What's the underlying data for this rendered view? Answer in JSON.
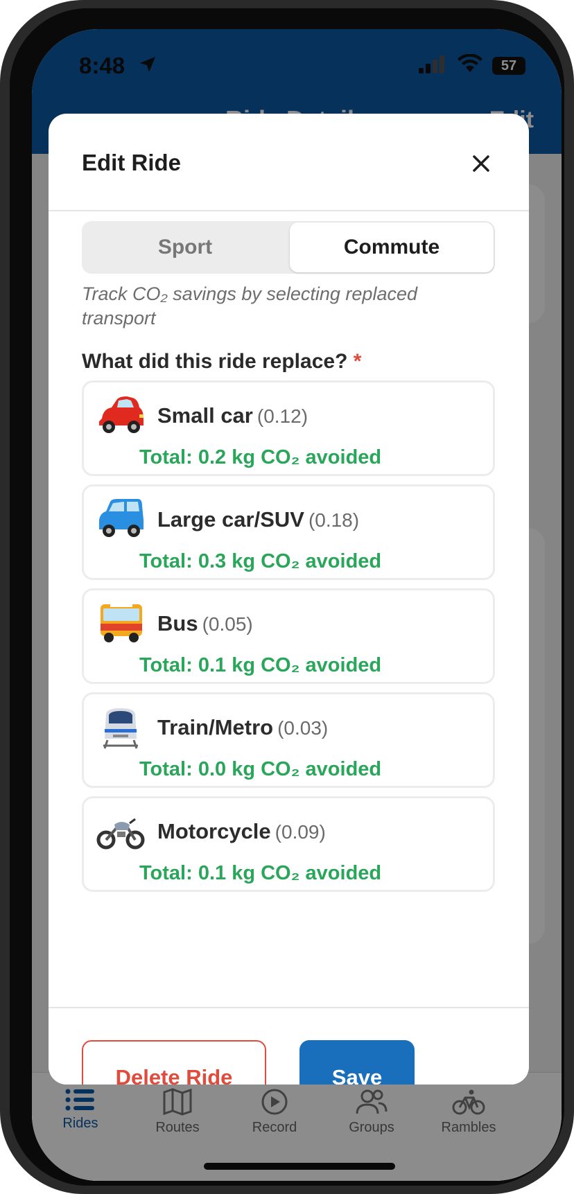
{
  "status_bar": {
    "time": "8:48",
    "battery": "57"
  },
  "app_header": {
    "title": "Ride Details",
    "edit_label": "Edit"
  },
  "tab_bar": {
    "items": [
      {
        "label": "Rides",
        "icon": "list-icon"
      },
      {
        "label": "Routes",
        "icon": "map-icon"
      },
      {
        "label": "Record",
        "icon": "play-icon"
      },
      {
        "label": "Groups",
        "icon": "group-icon"
      },
      {
        "label": "Rambles",
        "icon": "bike-icon"
      }
    ]
  },
  "modal": {
    "title": "Edit Ride",
    "segment": {
      "options": [
        "Sport",
        "Commute"
      ],
      "selected": "Commute"
    },
    "hint": "Track CO₂ savings by selecting replaced transport",
    "question": "What did this ride replace?",
    "required_mark": "*",
    "options": [
      {
        "name": "Small car",
        "factor": "(0.12)",
        "total": "Total: 0.2 kg CO₂ avoided",
        "icon": "red-car-icon"
      },
      {
        "name": "Large car/SUV",
        "factor": "(0.18)",
        "total": "Total: 0.3 kg CO₂ avoided",
        "icon": "blue-suv-icon"
      },
      {
        "name": "Bus",
        "factor": "(0.05)",
        "total": "Total: 0.1 kg CO₂ avoided",
        "icon": "bus-icon"
      },
      {
        "name": "Train/Metro",
        "factor": "(0.03)",
        "total": "Total: 0.0 kg CO₂ avoided",
        "icon": "train-icon"
      },
      {
        "name": "Motorcycle",
        "factor": "(0.09)",
        "total": "Total: 0.1 kg CO₂ avoided",
        "icon": "motorcycle-icon"
      }
    ],
    "delete_label": "Delete Ride",
    "save_label": "Save"
  },
  "colors": {
    "brand": "#0c5aa6",
    "save": "#1a6fbd",
    "delete": "#e04b3b",
    "co2_green": "#2aa65a"
  }
}
